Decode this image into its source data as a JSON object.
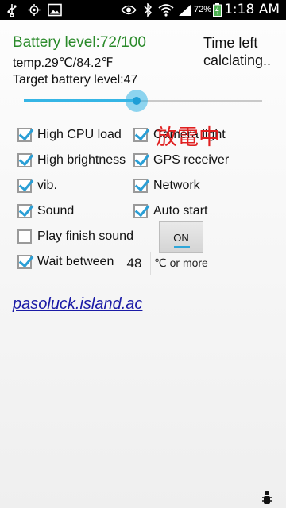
{
  "status_bar": {
    "icons": [
      "usb-icon",
      "gps-icon",
      "gallery-icon",
      "eye-icon",
      "bluetooth-icon",
      "wifi-icon",
      "signal-icon",
      "battery-icon"
    ],
    "battery_percent": "72%",
    "time": "1:18 AM"
  },
  "info": {
    "battery_level": "Battery level:72/100",
    "temperature": "temp.29℃/84.2℉",
    "target_level": "Target battery level:47",
    "time_left_line1": "Time left",
    "time_left_line2": "calclating.."
  },
  "slider": {
    "value": 47,
    "min": 0,
    "max": 100,
    "accent": "#35b5e5"
  },
  "discharge_label": "放電中",
  "options_left": [
    {
      "label": "High CPU load",
      "checked": true
    },
    {
      "label": "High brightness",
      "checked": true
    },
    {
      "label": "vib.",
      "checked": true
    },
    {
      "label": "Sound",
      "checked": true
    },
    {
      "label": "Play finish sound",
      "checked": false
    },
    {
      "label": "Wait between",
      "checked": true
    }
  ],
  "options_right": [
    {
      "label": "Camera light",
      "checked": true
    },
    {
      "label": "GPS receiver",
      "checked": true
    },
    {
      "label": "Network",
      "checked": true
    },
    {
      "label": "Auto start",
      "checked": true
    }
  ],
  "toggle": {
    "label": "ON",
    "state": "on"
  },
  "wait": {
    "value": "48",
    "unit": "℃ or more"
  },
  "link_text": "pasoluck.island.ac",
  "colors": {
    "battery_text": "#2a8a2a",
    "discharge": "#e02020",
    "link": "#1a1aa6",
    "check": "#2a9fd6"
  }
}
